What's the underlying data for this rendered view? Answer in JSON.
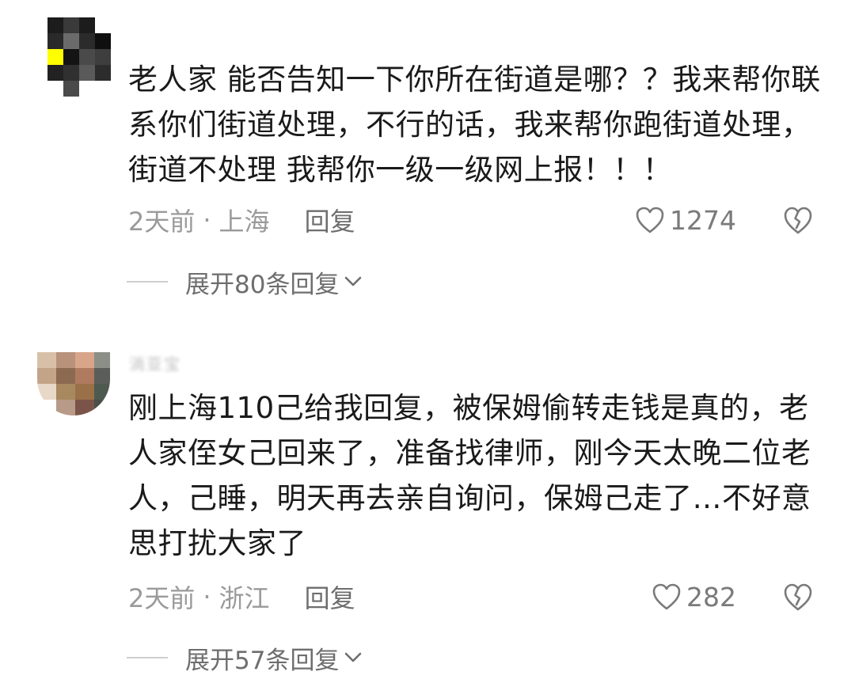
{
  "comments": [
    {
      "text": "老人家  能否告知一下你所在街道是哪？？我来帮你联系你们街道处理，不行的话，我来帮你跑街道处理，街道不处理  我帮你一级一级网上报！！！",
      "time": "2天前",
      "separator": "·",
      "location": "上海",
      "reply_label": "回复",
      "like_count": "1274",
      "expand_label": "展开80条回复"
    },
    {
      "username": "淌亚宝",
      "text": "刚上海110己给我回复，被保姆偷转走钱是真的，老人家侄女己回来了，准备找律师，刚今天太晚二位老人，己睡，明天再去亲自询问，保姆己走了…不好意思打扰大家了",
      "time": "2天前",
      "separator": "·",
      "location": "浙江",
      "reply_label": "回复",
      "like_count": "282",
      "expand_label": "展开57条回复"
    }
  ],
  "icons": {
    "like": "heart-outline-icon",
    "dislike": "broken-heart-icon",
    "expand": "chevron-down-icon"
  },
  "colors": {
    "text": "#1a1a1a",
    "meta": "#9a9a9a",
    "icon": "#7a7a7a"
  }
}
